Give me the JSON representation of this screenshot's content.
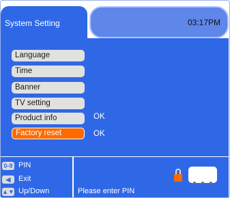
{
  "header": {
    "title": "System Setting",
    "time": "03:17PM"
  },
  "menu": {
    "items": [
      {
        "label": "Language",
        "value": ""
      },
      {
        "label": "Time",
        "value": ""
      },
      {
        "label": "Banner",
        "value": ""
      },
      {
        "label": "TV setting",
        "value": ""
      },
      {
        "label": "Product info",
        "value": "OK"
      },
      {
        "label": "Factory reset",
        "value": "OK",
        "selected": true
      }
    ]
  },
  "footer": {
    "hints": [
      {
        "key": "0-9",
        "label": "PIN",
        "icon": "numeric-keys-icon"
      },
      {
        "key": "◀",
        "label": "Exit",
        "icon": "left-arrow-icon"
      },
      {
        "key": "▲▼",
        "label": "Up/Down",
        "icon": "up-down-arrows-icon"
      }
    ],
    "status": "Please enter PIN",
    "pin_icon": "lock-icon"
  },
  "colors": {
    "panel": "#2f68e6",
    "time_box": "#5f86e9",
    "selected": "#ff6a00",
    "button": "#e1e1e1"
  }
}
